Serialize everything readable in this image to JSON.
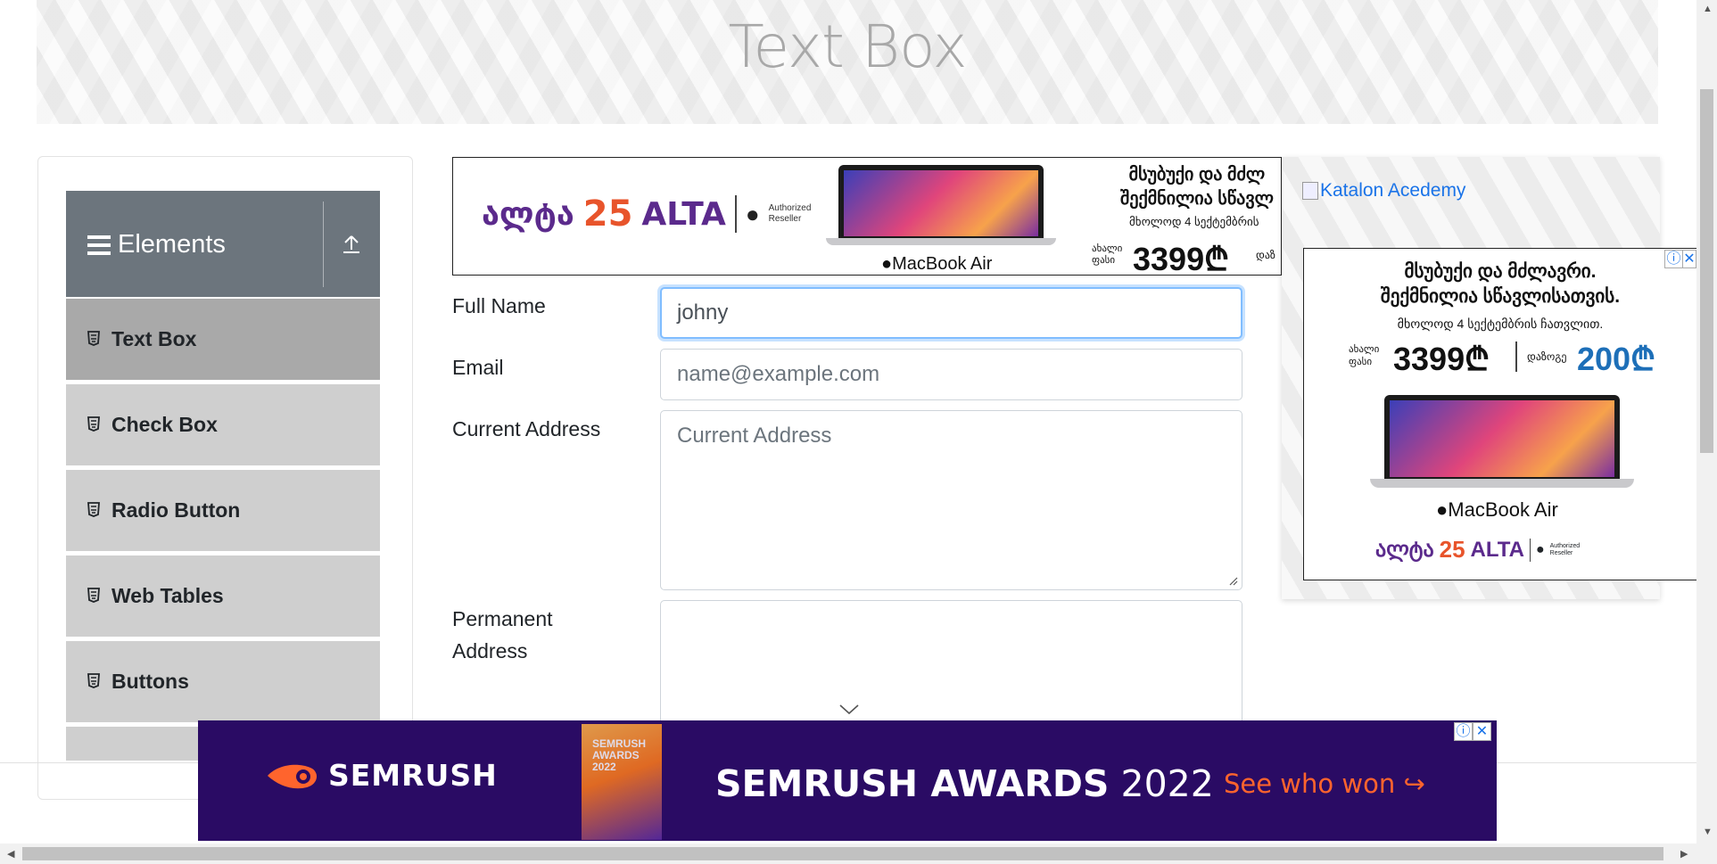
{
  "header": {
    "title": "Text Box"
  },
  "sidebar": {
    "group_title": "Elements",
    "items": [
      {
        "label": "Text Box",
        "active": true
      },
      {
        "label": "Check Box"
      },
      {
        "label": "Radio Button"
      },
      {
        "label": "Web Tables"
      },
      {
        "label": "Buttons"
      }
    ]
  },
  "form": {
    "full_name": {
      "label": "Full Name",
      "value": "johny"
    },
    "email": {
      "label": "Email",
      "placeholder": "name@example.com"
    },
    "current_address": {
      "label": "Current Address",
      "placeholder": "Current Address"
    },
    "permanent_address": {
      "label_line1": "Permanent",
      "label_line2": "Address"
    }
  },
  "ads": {
    "top_banner": {
      "brand_ka": "ალტა",
      "years": "25",
      "brand": "ALTA",
      "reseller": "Authorized Reseller",
      "product": "MacBook Air",
      "headline_1": "მსუბუქი და მძლ",
      "headline_2": "შექმნილია სწავლ",
      "sub": "მხოლოდ 4 სექტემბრის",
      "price_label_1": "ახალი",
      "price_label_2": "ფასი",
      "price": "3399₾",
      "discount_label": "დაზ"
    },
    "right_link": "Katalon Acedemy",
    "right_banner": {
      "headline_1": "მსუბუქი და მძლავრი.",
      "headline_2": "შექმნილია სწავლისათვის.",
      "sub": "მხოლოდ 4 სექტემბრის ჩათვლით.",
      "price_label_1": "ახალი",
      "price_label_2": "ფასი",
      "price": "3399₾",
      "discount_label": "დაზოგე",
      "discount": "200₾",
      "product": "MacBook Air",
      "brand_ka": "ალტა",
      "years": "25",
      "brand": "ALTA",
      "reseller": "Authorized Reseller"
    },
    "bottom_banner": {
      "brand": "SEMRUSH",
      "trophy_text": "SEMRUSH AWARDS 2022",
      "headline_bold": "SEMRUSH AWARDS",
      "headline_year": " 2022",
      "cta": "See who won"
    }
  },
  "colors": {
    "sidebar_header": "#6c757d",
    "menu_item": "#cfcfcf",
    "menu_item_active": "#a9a9a9",
    "focus_ring": "#80bdff",
    "semrush_bg": "#2a0b64",
    "semrush_orange": "#ff642d",
    "alta_purple": "#5b2a8c"
  }
}
